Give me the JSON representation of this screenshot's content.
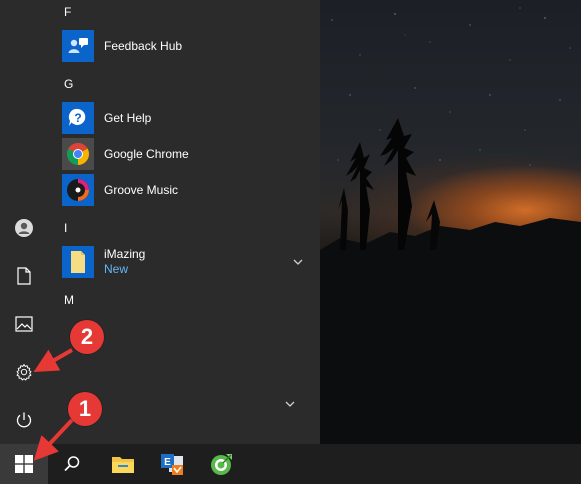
{
  "start_menu": {
    "groups": [
      {
        "letter": "F",
        "apps": [
          {
            "name": "Feedback Hub",
            "icon": "feedback-hub-icon",
            "color": "#0a64c9"
          }
        ]
      },
      {
        "letter": "G",
        "apps": [
          {
            "name": "Get Help",
            "icon": "get-help-icon",
            "color": "#0a64c9"
          },
          {
            "name": "Google Chrome",
            "icon": "chrome-icon",
            "color": "#4a4a4a"
          },
          {
            "name": "Groove Music",
            "icon": "groove-music-icon",
            "color": "#0a64c9"
          }
        ]
      },
      {
        "letter": "I",
        "apps": [
          {
            "name": "iMazing",
            "subtitle": "New",
            "icon": "imazing-icon",
            "color": "#0a64c9"
          }
        ]
      },
      {
        "letter": "M",
        "apps": []
      }
    ],
    "left_rail": [
      "user-icon",
      "documents-icon",
      "pictures-icon",
      "settings-icon",
      "power-icon"
    ]
  },
  "taskbar": {
    "items": [
      "windows-start-icon",
      "search-icon",
      "file-explorer-icon",
      "outlook-icon",
      "app-icon"
    ]
  },
  "annotations": [
    {
      "label": "1",
      "color": "#e63936"
    },
    {
      "label": "2",
      "color": "#e63936"
    }
  ]
}
